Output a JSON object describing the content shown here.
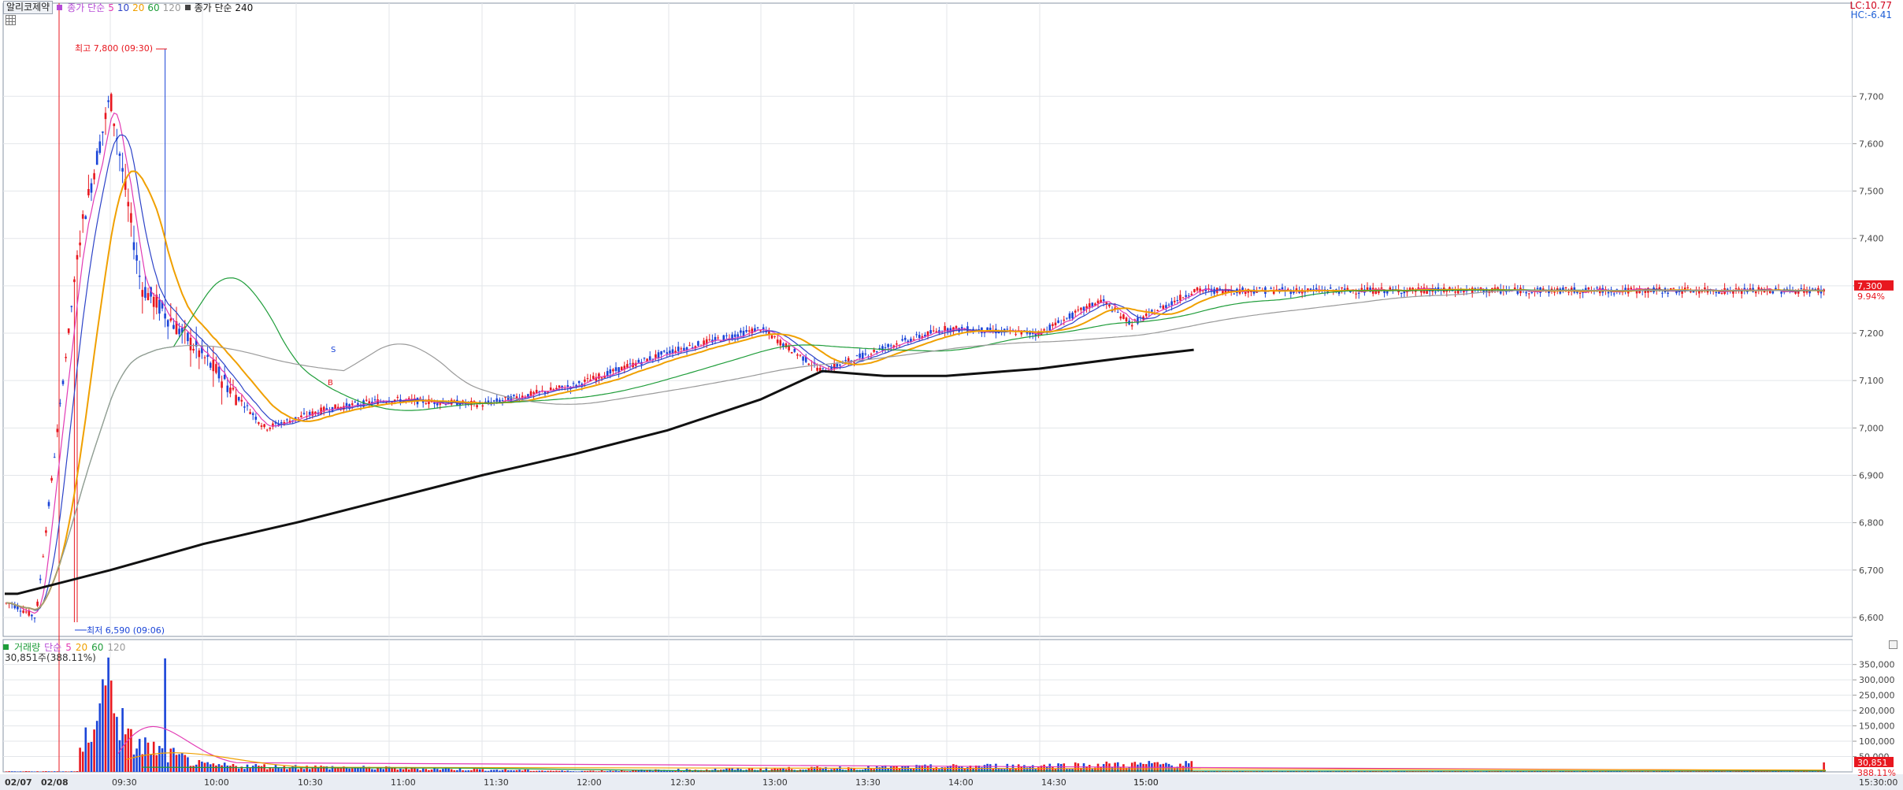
{
  "header": {
    "stock_name": "알리코제약",
    "ma_label": "종가 단순",
    "ma_periods": [
      "5",
      "10",
      "20",
      "60",
      "120"
    ],
    "ma240_label": "종가 단순 240",
    "lc": "LC:10.77",
    "hc": "HC:-6.41"
  },
  "annotations": {
    "high": "최고 7,800 (09:30)",
    "low": "최저 6,590 (09:06)",
    "s_marker": "S",
    "b_marker": "B"
  },
  "current": {
    "price": "7,300",
    "change": "9.94%",
    "volume": "30,851",
    "volume_ratio": "388.11%"
  },
  "volume_header": {
    "label": "거래량",
    "ma_label": "단순",
    "periods": [
      "5",
      "20",
      "60",
      "120"
    ],
    "summary": "30,851주(388.11%)"
  },
  "colors": {
    "up": "#e8171f",
    "down": "#1a44d8",
    "ma5": "#e23ab4",
    "ma10": "#2d43c8",
    "ma20": "#f0a000",
    "ma60": "#1f9d3a",
    "ma120": "#9a9a9a",
    "ma240": "#111111"
  },
  "chart_data": [
    {
      "type": "candlestick",
      "interval": "1 minute",
      "ylim": [
        6560,
        7870
      ],
      "y_ticks": [
        "7,700",
        "7,600",
        "7,500",
        "7,400",
        "7,300",
        "7,200",
        "7,100",
        "7,000",
        "6,900",
        "6,800",
        "6,700",
        "6,600"
      ],
      "y_tick_values": [
        7700,
        7600,
        7500,
        7400,
        7300,
        7200,
        7100,
        7000,
        6900,
        6800,
        6700,
        6600
      ],
      "x_ticks": [
        "02/07",
        "15:00",
        "02/08",
        "09:30",
        "10:00",
        "10:30",
        "11:00",
        "11:30",
        "12:00",
        "12:30",
        "13:00",
        "13:30",
        "14:00",
        "14:30",
        "15:00",
        "15:30:00"
      ],
      "date_separator": "02/08",
      "high": {
        "price": 7800,
        "time": "09:30"
      },
      "low": {
        "price": 6590,
        "time": "09:06"
      },
      "last_price": 7300,
      "key_points": [
        {
          "time": "02/07 15:00",
          "price": 6630
        },
        {
          "time": "09:06",
          "price": 6600
        },
        {
          "time": "09:20",
          "price": 7400
        },
        {
          "time": "09:30",
          "price": 7700
        },
        {
          "time": "09:40",
          "price": 7300
        },
        {
          "time": "10:00",
          "price": 7150
        },
        {
          "time": "10:20",
          "price": 7000
        },
        {
          "time": "10:40",
          "price": 7040
        },
        {
          "time": "11:00",
          "price": 7060
        },
        {
          "time": "11:30",
          "price": 7050
        },
        {
          "time": "12:00",
          "price": 7090
        },
        {
          "time": "12:30",
          "price": 7160
        },
        {
          "time": "13:00",
          "price": 7210
        },
        {
          "time": "13:20",
          "price": 7120
        },
        {
          "time": "13:40",
          "price": 7170
        },
        {
          "time": "14:00",
          "price": 7210
        },
        {
          "time": "14:30",
          "price": 7200
        },
        {
          "time": "14:50",
          "price": 7270
        },
        {
          "time": "15:00",
          "price": 7220
        },
        {
          "time": "15:20",
          "price": 7290
        }
      ],
      "series": [
        {
          "name": "5",
          "color": "#e23ab4"
        },
        {
          "name": "10",
          "color": "#2d43c8"
        },
        {
          "name": "20",
          "color": "#f0a000"
        },
        {
          "name": "60",
          "color": "#1f9d3a"
        },
        {
          "name": "120",
          "color": "#9a9a9a"
        },
        {
          "name": "240",
          "color": "#111111"
        }
      ],
      "ma240_points": [
        {
          "time": "09:00",
          "price": 6650
        },
        {
          "time": "09:30",
          "price": 6700
        },
        {
          "time": "10:00",
          "price": 6755
        },
        {
          "time": "10:30",
          "price": 6800
        },
        {
          "time": "11:00",
          "price": 6850
        },
        {
          "time": "11:30",
          "price": 6900
        },
        {
          "time": "12:00",
          "price": 6945
        },
        {
          "time": "12:30",
          "price": 6995
        },
        {
          "time": "13:00",
          "price": 7060
        },
        {
          "time": "13:20",
          "price": 7120
        },
        {
          "time": "13:40",
          "price": 7110
        },
        {
          "time": "14:00",
          "price": 7110
        },
        {
          "time": "14:30",
          "price": 7125
        },
        {
          "time": "15:00",
          "price": 7150
        },
        {
          "time": "15:20",
          "price": 7165
        }
      ]
    },
    {
      "type": "bar",
      "name": "거래량",
      "ylim": [
        0,
        380000
      ],
      "y_ticks": [
        "350,000",
        "300,000",
        "250,000",
        "200,000",
        "150,000",
        "100,000",
        "50,000"
      ],
      "y_tick_values": [
        350000,
        300000,
        250000,
        200000,
        150000,
        100000,
        50000
      ],
      "key_points": [
        {
          "time": "09:20",
          "volume": 60000
        },
        {
          "time": "09:30",
          "volume": 370000
        },
        {
          "time": "09:35",
          "volume": 120000
        },
        {
          "time": "10:00",
          "volume": 25000
        },
        {
          "time": "12:00",
          "volume": 3000
        },
        {
          "time": "15:20",
          "volume": 30851
        }
      ]
    }
  ]
}
